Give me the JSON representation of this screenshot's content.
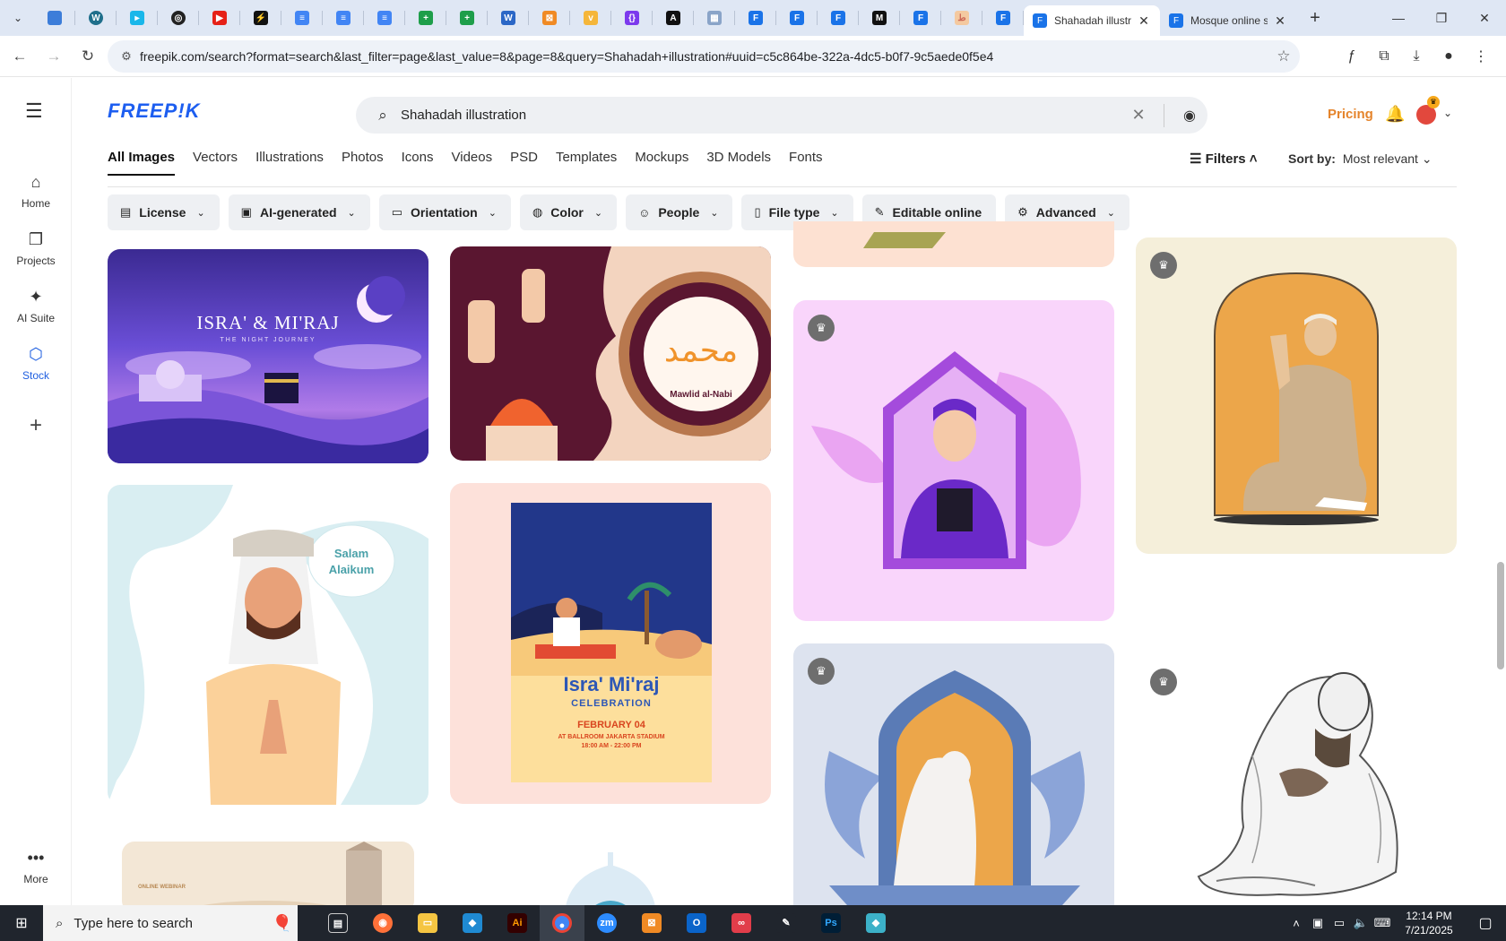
{
  "browser": {
    "tabs": [
      {
        "label": "Shahadah illustra",
        "active": true
      },
      {
        "label": "Mosque online s",
        "active": false
      }
    ],
    "pinned_icons": [
      "edge-icon",
      "wordpress-icon",
      "vimeo-icon",
      "chatgpt-icon",
      "youtube-icon",
      "bolt-icon",
      "docs-icon",
      "docs-icon",
      "docs-icon",
      "sheets-icon",
      "sheets-icon",
      "word-icon",
      "xampp-icon",
      "app-icon",
      "brackets-icon",
      "app-icon",
      "app-icon",
      "forms-icon",
      "forms-icon",
      "medium-icon",
      "forms-icon",
      "app-icon",
      "forms-icon"
    ],
    "url": "freepik.com/search?format=search&last_filter=page&last_value=8&page=8&query=Shahadah+illustration#uuid=c5c864be-322a-4dc5-b0f7-9c5aede0f5e4"
  },
  "sidebar": {
    "items": [
      {
        "label": "Home",
        "icon": "home-icon"
      },
      {
        "label": "Projects",
        "icon": "projects-icon"
      },
      {
        "label": "AI Suite",
        "icon": "sparkle-icon"
      },
      {
        "label": "Stock",
        "icon": "stock-icon"
      }
    ],
    "more_label": "More"
  },
  "header": {
    "logo": "FREEP!K",
    "search_value": "Shahadah illustration",
    "pricing_label": "Pricing"
  },
  "categories": [
    "All Images",
    "Vectors",
    "Illustrations",
    "Photos",
    "Icons",
    "Videos",
    "PSD",
    "Templates",
    "Mockups",
    "3D Models",
    "Fonts"
  ],
  "filters_label": "Filters",
  "sort": {
    "label": "Sort by:",
    "value": "Most relevant"
  },
  "chips": [
    "License",
    "AI-generated",
    "Orientation",
    "Color",
    "People",
    "File type",
    "Editable online",
    "Advanced"
  ],
  "cards": {
    "isra_title": "ISRA' & MI'RAJ",
    "isra_sub": "THE NIGHT JOURNEY",
    "mawlid_caption": "Mawlid al-Nabi",
    "salam": "Salam Alaikum",
    "poster_title": "Isra' Mi'raj",
    "poster_sub": "CELEBRATION",
    "poster_date": "FEBRUARY 04",
    "poster_place": "AT BALLROOM JAKARTA STADIUM",
    "poster_time": "18:00 AM - 22:00 PM",
    "webinar": "ONLINE WEBINAR"
  },
  "taskbar": {
    "search_placeholder": "Type here to search",
    "time": "12:14 PM",
    "date": "7/21/2025"
  },
  "colors": {
    "brand": "#1d5ef0",
    "pricing": "#e5842b"
  }
}
